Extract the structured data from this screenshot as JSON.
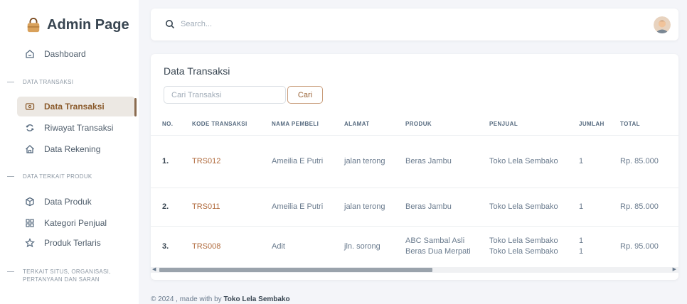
{
  "brand": {
    "title": "Admin Page",
    "icon": "shopping-bag-icon"
  },
  "sidebar": {
    "items": [
      {
        "label": "Dashboard",
        "icon": "home-smile-icon"
      },
      {
        "section": "DATA TRANSAKSI"
      },
      {
        "label": "Data Transaksi",
        "icon": "receipt-icon",
        "active": true
      },
      {
        "label": "Riwayat Transaksi",
        "icon": "refresh-icon"
      },
      {
        "label": "Data Rekening",
        "icon": "home-icon"
      },
      {
        "section": "DATA TERKAIT PRODUK"
      },
      {
        "label": "Data Produk",
        "icon": "cube-icon"
      },
      {
        "label": "Kategori Penjual",
        "icon": "grid-icon"
      },
      {
        "label": "Produk Terlaris",
        "icon": "star-icon"
      },
      {
        "section_line1": "TERKAIT SITUS, ORGANISASI,",
        "section_line2": "PERTANYAAN DAN SARAN"
      }
    ]
  },
  "topbar": {
    "search_placeholder": "Search..."
  },
  "main": {
    "title": "Data Transaksi",
    "search_placeholder": "Cari Transaksi",
    "search_button": "Cari",
    "table": {
      "headers": [
        "NO.",
        "KODE TRANSAKSI",
        "NAMA PEMBELI",
        "ALAMAT",
        "PRODUK",
        "PENJUAL",
        "JUMLAH",
        "TOTAL"
      ],
      "rows": [
        {
          "no": "1.",
          "kode": "TRS012",
          "nama": "Ameilia E Putri",
          "alamat": "jalan terong",
          "produk": [
            "Beras Jambu"
          ],
          "penjual": [
            "Toko Lela Sembako"
          ],
          "jumlah": [
            "1"
          ],
          "total": "Rp. 85.000"
        },
        {
          "no": "2.",
          "kode": "TRS011",
          "nama": "Ameilia E Putri",
          "alamat": "jalan terong",
          "produk": [
            "Beras Jambu"
          ],
          "penjual": [
            "Toko Lela Sembako"
          ],
          "jumlah": [
            "1"
          ],
          "total": "Rp. 85.000"
        },
        {
          "no": "3.",
          "kode": "TRS008",
          "nama": "Adit",
          "alamat": "jln. sorong",
          "produk": [
            "ABC Sambal Asli",
            "Beras Dua Merpati"
          ],
          "penjual": [
            "Toko Lela Sembako",
            "Toko Lela Sembako"
          ],
          "jumlah": [
            "1",
            "1"
          ],
          "total": "Rp. 95.000"
        }
      ]
    }
  },
  "footer": {
    "prefix": "© 2024 , made with by",
    "brand": "Toko Lela Sembako"
  },
  "colors": {
    "accent": "#9a6438",
    "active_bg": "#ece8e3",
    "link": "#b06a3c"
  }
}
